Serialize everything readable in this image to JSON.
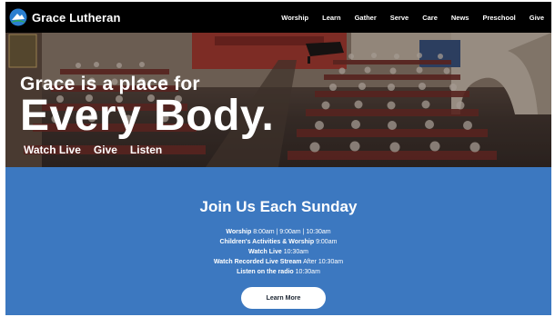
{
  "header": {
    "brand": "Grace Lutheran",
    "nav": [
      "Worship",
      "Learn",
      "Gather",
      "Serve",
      "Care",
      "News",
      "Preschool",
      "Give"
    ]
  },
  "hero": {
    "line1": "Grace is a place for",
    "line2": "Every Body.",
    "links": [
      "Watch Live",
      "Give",
      "Listen"
    ]
  },
  "sunday": {
    "title": "Join Us Each Sunday",
    "schedule": [
      {
        "label": "Worship",
        "value": "8:00am | 9:00am | 10:30am"
      },
      {
        "label": "Children's Activities & Worship",
        "value": "9:00am"
      },
      {
        "label": "Watch Live",
        "value": "10:30am"
      },
      {
        "label": "Watch Recorded Live Stream",
        "value": "After 10:30am"
      },
      {
        "label": "Listen on the radio",
        "value": "10:30am"
      }
    ],
    "button": "Learn More"
  },
  "icons": {
    "logo": "grace-lutheran-logo-icon"
  },
  "colors": {
    "topbar": "#000000",
    "section_blue": "#3c78c0",
    "button_bg": "#ffffff"
  }
}
